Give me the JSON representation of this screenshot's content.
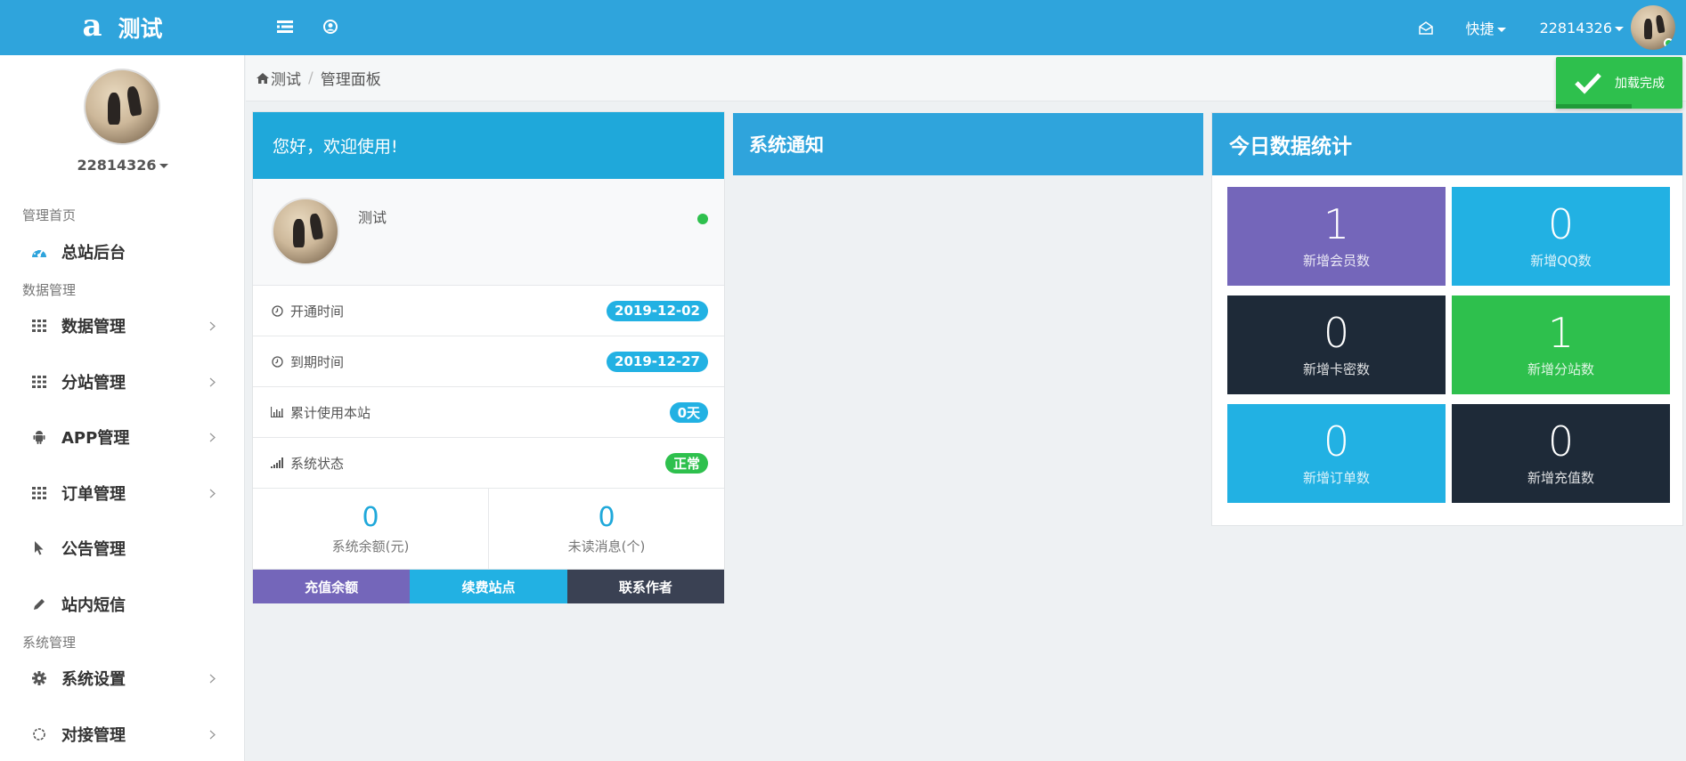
{
  "colors": {
    "primary": "#2fa4dc",
    "cyan": "#22b1e3",
    "purple": "#7466ba",
    "dark": "#1e2a38",
    "green": "#2ec04d",
    "darkgray": "#3a4153"
  },
  "header": {
    "logo": "a",
    "site_name": "测试",
    "quick_label": "快捷",
    "username": "22814326"
  },
  "sidebar": {
    "username": "22814326",
    "groups": [
      "管理首页",
      "数据管理",
      "系统管理"
    ],
    "items": [
      {
        "label": "总站后台",
        "icon": "dashboard-icon"
      },
      {
        "label": "数据管理",
        "icon": "grid-icon"
      },
      {
        "label": "分站管理",
        "icon": "grid-icon"
      },
      {
        "label": "APP管理",
        "icon": "android-icon"
      },
      {
        "label": "订单管理",
        "icon": "grid-icon"
      },
      {
        "label": "公告管理",
        "icon": "cursor-icon"
      },
      {
        "label": "站内短信",
        "icon": "pencil-icon"
      },
      {
        "label": "系统设置",
        "icon": "gear-icon"
      },
      {
        "label": "对接管理",
        "icon": "circle-notch-icon"
      }
    ]
  },
  "breadcrumb": {
    "home": "测试",
    "current": "管理面板"
  },
  "toast": {
    "text": "加载完成",
    "progress": 0.6
  },
  "welcome": {
    "title": "您好，欢迎使用!",
    "name": "测试",
    "rows": [
      {
        "label": "开通时间",
        "value": "2019-12-02",
        "icon": "clock-icon"
      },
      {
        "label": "到期时间",
        "value": "2019-12-27",
        "icon": "clock-icon"
      },
      {
        "label": "累计使用本站",
        "value": "0天",
        "icon": "bar-chart-icon"
      },
      {
        "label": "系统状态",
        "value": "正常",
        "icon": "signal-icon"
      }
    ],
    "balance": {
      "value": "0",
      "label": "系统余额(元)"
    },
    "unread": {
      "value": "0",
      "label": "未读消息(个)"
    },
    "buttons": [
      "充值余额",
      "续费站点",
      "联系作者"
    ]
  },
  "notice": {
    "title": "系统通知"
  },
  "today": {
    "title": "今日数据统计",
    "tiles": [
      {
        "value": "1",
        "label": "新增会员数",
        "color": "#7466ba"
      },
      {
        "value": "0",
        "label": "新增QQ数",
        "color": "#22b1e3"
      },
      {
        "value": "0",
        "label": "新增卡密数",
        "color": "#1e2a38"
      },
      {
        "value": "1",
        "label": "新增分站数",
        "color": "#2ec04d"
      },
      {
        "value": "0",
        "label": "新增订单数",
        "color": "#22b1e3"
      },
      {
        "value": "0",
        "label": "新增充值数",
        "color": "#1e2a38"
      }
    ]
  }
}
